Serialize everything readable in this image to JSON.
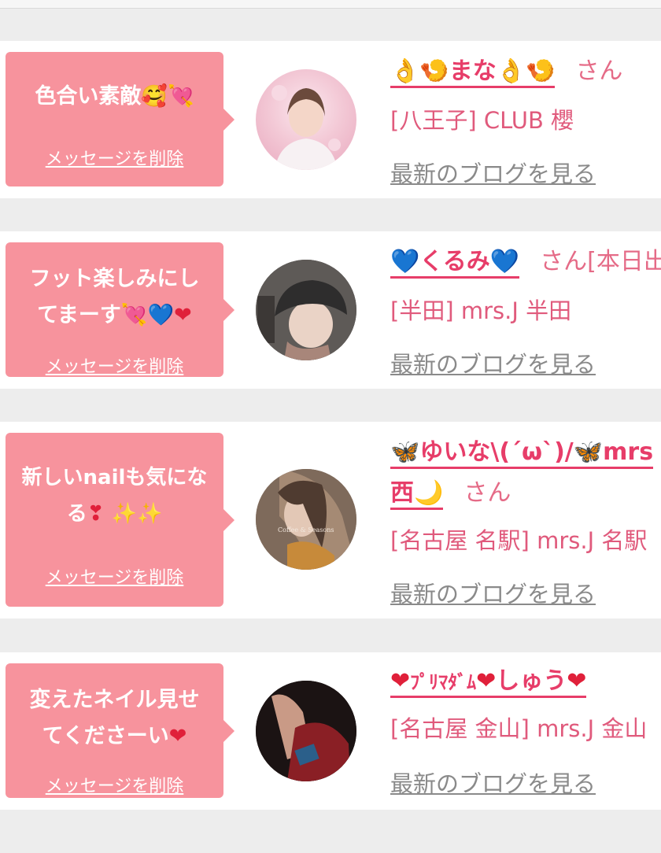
{
  "delete_label": "メッセージを削除",
  "blog_label": "最新のブログを見る",
  "san": "さん",
  "cards": [
    {
      "message": "色合い素敵",
      "name_core": "まな",
      "name_suffix": "さん",
      "shop": "[八王子] CLUB 櫻",
      "avatar_colors": [
        "#f3c9d6",
        "#e8a7bd",
        "#fbe7ee"
      ]
    },
    {
      "message_line1": "フット楽しみにし",
      "message_line2": "てまーす",
      "name_core": "くるみ",
      "name_suffix": "さん[本日出",
      "shop": "[半田] mrs.J 半田",
      "avatar_colors": [
        "#3a3a3a",
        "#6a6461",
        "#c9b7a8"
      ]
    },
    {
      "message_line1": "新しいnailも気にな",
      "message_line2": "る",
      "name_line1": "ゆいな\\(´ω`)/",
      "name_line1_tail": "mrs",
      "name_line2": "西",
      "name_suffix": "さん",
      "shop": "[名古屋 名駅] mrs.J 名駅",
      "avatar_colors": [
        "#8c7563",
        "#b59a86",
        "#5e4a3d"
      ]
    },
    {
      "message_line1": "変えたネイル見せ",
      "message_line2": "てくださーい",
      "name_core": "ﾌﾟﾘﾏﾀﾞﾑ",
      "name_core2": "しゅう",
      "shop": "[名古屋 金山] mrs.J 金山",
      "avatar_colors": [
        "#1a1212",
        "#7a2226",
        "#b64b3f"
      ]
    }
  ],
  "icons": {
    "ok_hand": "👌",
    "shrimp": "🍤",
    "smile_hearts": "🥰",
    "arrow_heart": "💘",
    "blue_heart": "💙",
    "red_heart": "❤",
    "butterfly": "🦋",
    "moon": "🌙",
    "sparkles": "✨",
    "heart_exclaim": "❣"
  },
  "colors": {
    "bubble": "#f7939d",
    "name": "#e73d69",
    "shop": "#e05a7c",
    "link_gray": "#8a8a8a"
  }
}
